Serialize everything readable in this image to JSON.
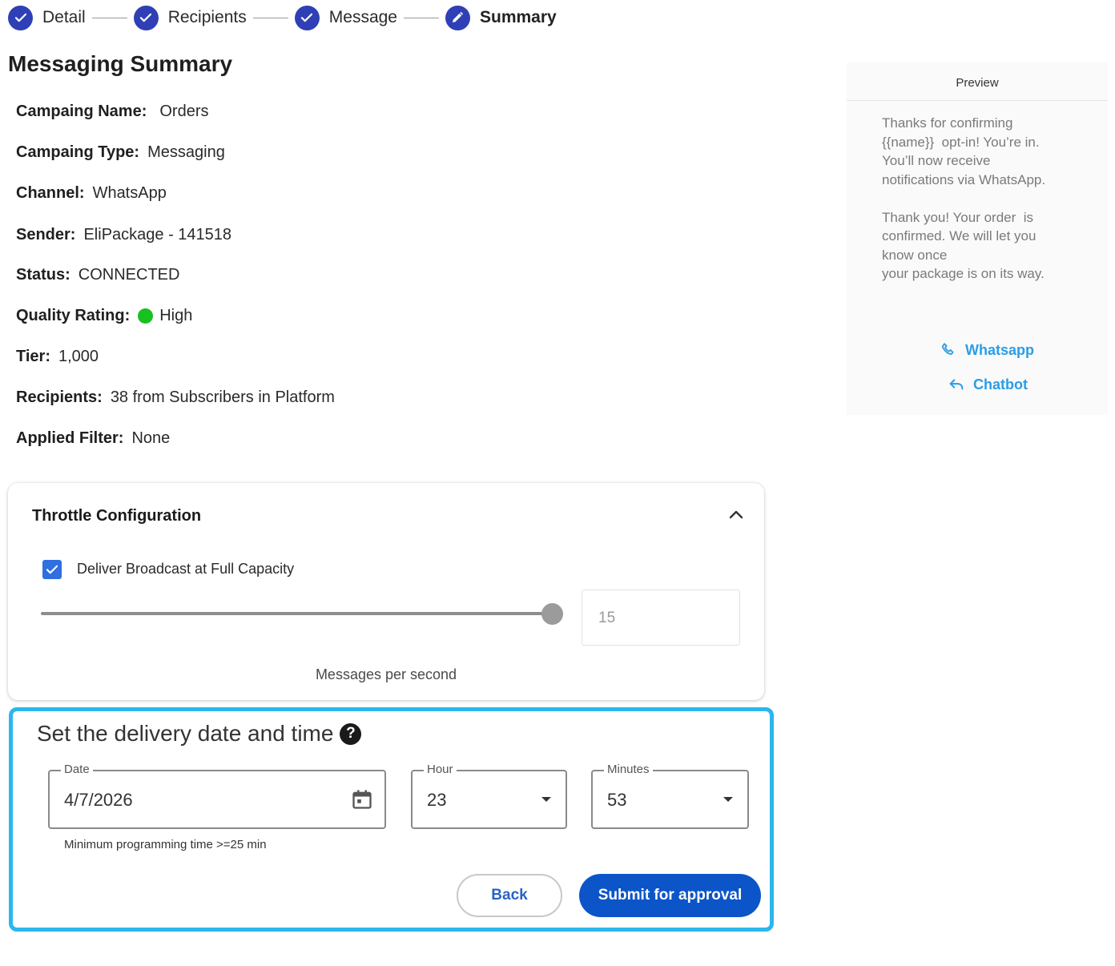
{
  "stepper": {
    "steps": [
      {
        "label": "Detail",
        "state": "done"
      },
      {
        "label": "Recipients",
        "state": "done"
      },
      {
        "label": "Message",
        "state": "done"
      },
      {
        "label": "Summary",
        "state": "active"
      }
    ]
  },
  "page_title": "Messaging Summary",
  "summary": {
    "campaign_name": {
      "label": "Campaing Name:",
      "value": "Orders"
    },
    "campaign_type": {
      "label": "Campaing Type:",
      "value": "Messaging"
    },
    "channel": {
      "label": "Channel:",
      "value": "WhatsApp"
    },
    "sender": {
      "label": "Sender:",
      "value": "EliPackage - 141518"
    },
    "status": {
      "label": "Status:",
      "value": "CONNECTED"
    },
    "quality_rating": {
      "label": "Quality Rating:",
      "value": "High",
      "indicator_color": "#18c11f"
    },
    "tier": {
      "label": "Tier:",
      "value": "1,000"
    },
    "recipients": {
      "label": "Recipients:",
      "value": "38 from Subscribers in Platform"
    },
    "applied_filter": {
      "label": "Applied Filter:",
      "value": "None"
    }
  },
  "throttle": {
    "title": "Throttle Configuration",
    "expanded": true,
    "full_capacity_label": "Deliver Broadcast at Full Capacity",
    "full_capacity_checked": true,
    "slider_level": 1.0,
    "messages_per_second": "15",
    "messages_per_second_label": "Messages per second"
  },
  "delivery": {
    "title": "Set the delivery date and time",
    "help_glyph": "?",
    "date": {
      "label": "Date",
      "value": "4/7/2026"
    },
    "hour": {
      "label": "Hour",
      "value": "23"
    },
    "minutes": {
      "label": "Minutes",
      "value": "53"
    },
    "hint": "Minimum programming time >=25 min",
    "back_label": "Back",
    "submit_label": "Submit for approval"
  },
  "preview": {
    "header": "Preview",
    "message": "Thanks for confirming\n{{name}}  opt-in! You’re in.\nYou’ll now receive\nnotifications via WhatsApp.\n\nThank you! Your order  is\nconfirmed. We will let you\nknow once\nyour package is on its way.",
    "buttons": [
      {
        "label": "Whatsapp",
        "icon": "phone-icon"
      },
      {
        "label": "Chatbot",
        "icon": "reply-icon"
      }
    ]
  },
  "colors": {
    "step_accent": "#2f3fb5",
    "focus_border": "#2bb7ee",
    "primary_button": "#0c55c9",
    "preview_link": "#2a9de6"
  }
}
